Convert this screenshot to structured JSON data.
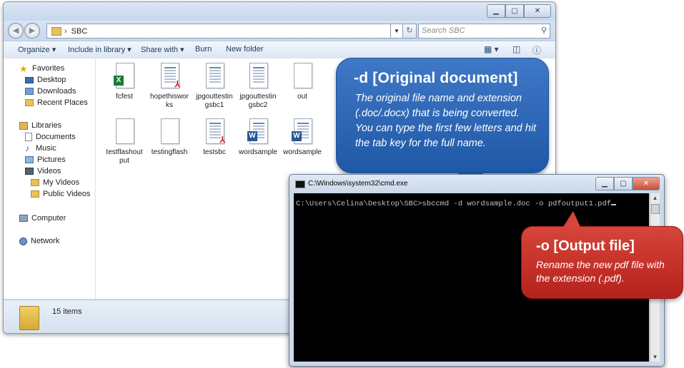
{
  "explorer": {
    "address": {
      "path": "SBC",
      "separator": "›"
    },
    "search": {
      "placeholder": "Search SBC"
    },
    "toolbar": {
      "organize": "Organize ▾",
      "include": "Include in library ▾",
      "share": "Share with ▾",
      "burn": "Burn",
      "new_folder": "New folder"
    },
    "sidebar": {
      "favorites": "Favorites",
      "desktop": "Desktop",
      "downloads": "Downloads",
      "recent": "Recent Places",
      "libraries": "Libraries",
      "documents": "Documents",
      "music": "Music",
      "pictures": "Pictures",
      "videos": "Videos",
      "my_videos": "My Videos",
      "public_videos": "Public Videos",
      "computer": "Computer",
      "network": "Network"
    },
    "files": [
      {
        "name": "fcfest",
        "kind": "excel"
      },
      {
        "name": "hopethisworks",
        "kind": "pdf-thumb"
      },
      {
        "name": "jpgouttestingsbc1",
        "kind": "thumb"
      },
      {
        "name": "jpgouttestingsbc2",
        "kind": "thumb"
      },
      {
        "name": "out",
        "kind": "blank"
      },
      {
        "name": "testflashoutput",
        "kind": "blank"
      },
      {
        "name": "testingflash",
        "kind": "blank"
      },
      {
        "name": "testsbc",
        "kind": "pdf"
      },
      {
        "name": "wordsample",
        "kind": "word"
      },
      {
        "name": "wordsample",
        "kind": "word"
      }
    ],
    "status": {
      "count": "15 items"
    }
  },
  "cmd": {
    "title": "C:\\Windows\\system32\\cmd.exe",
    "line": "C:\\Users\\Celina\\Desktop\\SBC>sbccmd -d wordsample.doc -o pdfoutput1.pdf"
  },
  "callouts": {
    "d_title": "-d [Original  document]",
    "d_text": "The original file name and extension (.doc/.docx) that is being converted. You can type the first few  letters and hit the tab key for the full name.",
    "o_title": "-o [Output file]",
    "o_text": "Rename the new pdf file with the extension (.pdf)."
  },
  "colors": {
    "blue_callout": "#2a64b4",
    "red_callout": "#c4302a",
    "cmd_bg": "#000000"
  }
}
